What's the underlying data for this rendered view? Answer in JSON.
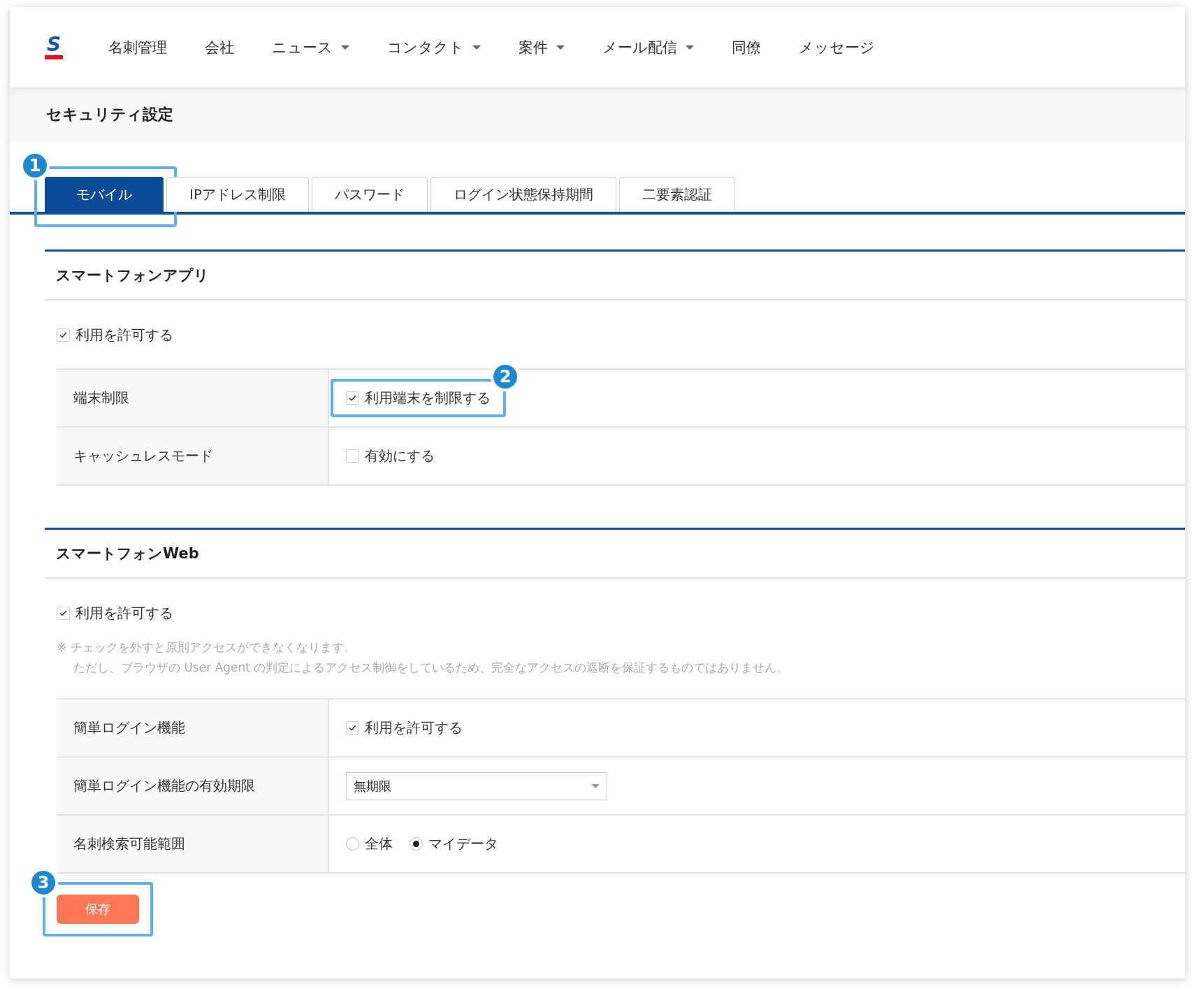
{
  "nav": {
    "logo": "S",
    "items": [
      {
        "label": "名刺管理",
        "dropdown": false
      },
      {
        "label": "会社",
        "dropdown": false
      },
      {
        "label": "ニュース",
        "dropdown": true
      },
      {
        "label": "コンタクト",
        "dropdown": true
      },
      {
        "label": "案件",
        "dropdown": true
      },
      {
        "label": "メール配信",
        "dropdown": true
      },
      {
        "label": "同僚",
        "dropdown": false
      },
      {
        "label": "メッセージ",
        "dropdown": false
      }
    ]
  },
  "page_title": "セキュリティ設定",
  "tabs": [
    {
      "label": "モバイル",
      "selected": true,
      "callout": "1"
    },
    {
      "label": "IPアドレス制限",
      "selected": false
    },
    {
      "label": "パスワード",
      "selected": false
    },
    {
      "label": "ログイン状態保持期間",
      "selected": false
    },
    {
      "label": "二要素認証",
      "selected": false
    }
  ],
  "sections": [
    {
      "title": "スマートフォンアプリ",
      "allow": {
        "label": "利用を許可する",
        "checked": true
      },
      "rows": [
        {
          "kind": "checkbox",
          "label": "端末制限",
          "option": "利用端末を制限する",
          "checked": true,
          "callout": "2"
        },
        {
          "kind": "checkbox",
          "label": "キャッシュレスモード",
          "option": "有効にする",
          "checked": false
        }
      ]
    },
    {
      "title": "スマートフォンWeb",
      "allow": {
        "label": "利用を許可する",
        "checked": true
      },
      "notes": [
        "※ チェックを外すと原則アクセスができなくなります。",
        "ただし、ブラウザの User Agent の判定によるアクセス制御をしているため、完全なアクセスの遮断を保証するものではありません。"
      ],
      "rows": [
        {
          "kind": "checkbox",
          "label": "簡単ログイン機能",
          "option": "利用を許可する",
          "checked": true
        },
        {
          "kind": "select",
          "label": "簡単ログイン機能の有効期限",
          "value": "無期限"
        },
        {
          "kind": "radio",
          "label": "名刺検索可能範囲",
          "options": [
            {
              "label": "全体",
              "selected": false
            },
            {
              "label": "マイデータ",
              "selected": true
            }
          ]
        }
      ]
    }
  ],
  "save": {
    "label": "保存",
    "callout": "3"
  }
}
